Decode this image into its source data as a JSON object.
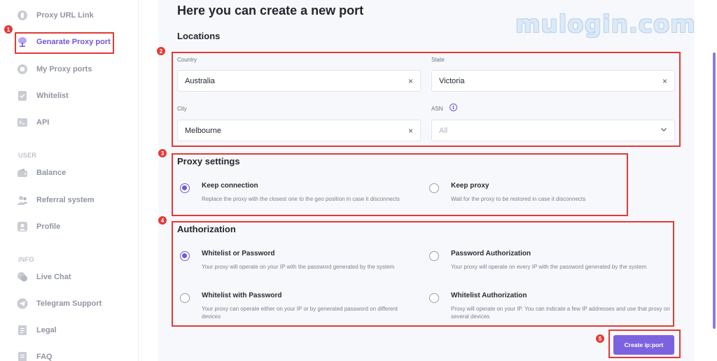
{
  "sidebar": {
    "items": [
      {
        "label": "Proxy URL Link",
        "icon": "proxy-link-icon"
      },
      {
        "label": "Genarate Proxy port",
        "icon": "generate-port-icon",
        "active": true
      },
      {
        "label": "My Proxy ports",
        "icon": "proxy-ports-icon"
      },
      {
        "label": "Whitelist",
        "icon": "whitelist-icon"
      },
      {
        "label": "API",
        "icon": "api-terminal-icon"
      }
    ],
    "user_section": "USER",
    "user_items": [
      {
        "label": "Balance",
        "icon": "wallet-icon"
      },
      {
        "label": "Referral system",
        "icon": "users-icon"
      },
      {
        "label": "Profile",
        "icon": "profile-icon"
      }
    ],
    "info_section": "INFO",
    "info_items": [
      {
        "label": "Live Chat",
        "icon": "chat-icon"
      },
      {
        "label": "Telegram Support",
        "icon": "telegram-icon"
      },
      {
        "label": "Legal",
        "icon": "legal-doc-icon"
      },
      {
        "label": "FAQ",
        "icon": "faq-icon"
      }
    ]
  },
  "main": {
    "title": "Here you can create a new port",
    "locations": {
      "heading": "Locations",
      "country_label": "Country",
      "country_value": "Australia",
      "state_label": "State",
      "state_value": "Victoria",
      "city_label": "City",
      "city_value": "Melbourne",
      "asn_label": "ASN",
      "asn_value": "All",
      "info_glyph": "i",
      "clear_glyph": "×"
    },
    "proxy_settings": {
      "heading": "Proxy settings",
      "keep_connection": {
        "title": "Keep connection",
        "desc": "Replace the proxy with the closest one to the geo position in case it disconnects",
        "checked": true
      },
      "keep_proxy": {
        "title": "Keep proxy",
        "desc": "Wait for the proxy to be restored in case it disconnects",
        "checked": false
      }
    },
    "authorization": {
      "heading": "Authorization",
      "whitelist_or_password": {
        "title": "Whitelist or Password",
        "desc": "Your proxy will operate on your IP with the password generated by the system",
        "checked": true
      },
      "password_authorization": {
        "title": "Password Authorization",
        "desc": "Your proxy will operate on every IP with the password generated by the system",
        "checked": false
      },
      "whitelist_with_password": {
        "title": "Whitelist with Password",
        "desc": "Your proxy can operate either on your IP or by generated password on different devices",
        "checked": false
      },
      "whitelist_authorization": {
        "title": "Whitelist Authorization",
        "desc": "Proxy will operate on your IP. You can indicate a few IP addresses and use that proxy on several devices",
        "checked": false
      }
    },
    "create_button": "Create ip:port"
  },
  "annotations": {
    "badges": [
      "1",
      "2",
      "3",
      "4",
      "5"
    ],
    "highlight_color": "#e53935"
  },
  "watermark": "mulogin.com",
  "colors": {
    "accent": "#7257d8",
    "button": "#7d62e0",
    "sidebar_text": "#8f95a3"
  }
}
